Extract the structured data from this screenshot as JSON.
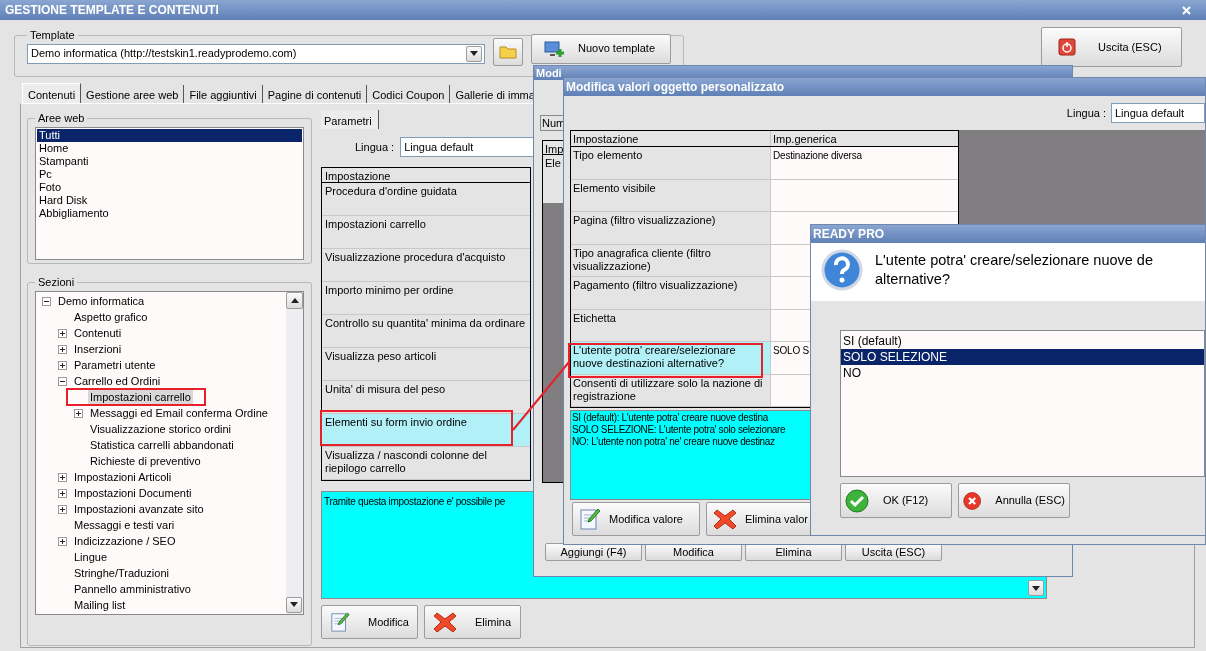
{
  "window": {
    "title": "GESTIONE TEMPLATE E CONTENUTI"
  },
  "template": {
    "label": "Template",
    "value": "Demo informatica (http://testskin1.readyprodemo.com)",
    "new_button": "Nuovo template"
  },
  "exit_button": "Uscita (ESC)",
  "tabs": [
    {
      "label": "Contenuti",
      "selected": true
    },
    {
      "label": "Gestione aree web",
      "selected": false
    },
    {
      "label": "File aggiuntivi",
      "selected": false
    },
    {
      "label": "Pagine di contenuti",
      "selected": false
    },
    {
      "label": "Codici Coupon",
      "selected": false
    },
    {
      "label": "Gallerie di imma",
      "selected": false
    }
  ],
  "web_areas": {
    "label": "Aree web",
    "items": [
      {
        "label": "Tutti",
        "selected": true
      },
      {
        "label": "Home",
        "selected": false
      },
      {
        "label": "Stampanti",
        "selected": false
      },
      {
        "label": "Pc",
        "selected": false
      },
      {
        "label": "Foto",
        "selected": false
      },
      {
        "label": "Hard Disk",
        "selected": false
      },
      {
        "label": "Abbigliamento",
        "selected": false
      }
    ]
  },
  "sections": {
    "label": "Sezioni",
    "tree": [
      {
        "label": "Demo informatica",
        "kind": "group",
        "expanded": true,
        "selected": false,
        "children": [
          {
            "label": "Aspetto grafico",
            "kind": "leaf",
            "selected": false
          },
          {
            "label": "Contenuti",
            "kind": "group",
            "expanded": false,
            "selected": false
          },
          {
            "label": "Inserzioni",
            "kind": "group",
            "expanded": false,
            "selected": false
          },
          {
            "label": "Parametri utente",
            "kind": "group",
            "expanded": false,
            "selected": false
          },
          {
            "label": "Carrello ed Ordini",
            "kind": "group",
            "expanded": true,
            "selected": false,
            "children": [
              {
                "label": "Impostazioni carrello",
                "kind": "leaf",
                "selected": true
              },
              {
                "label": "Messaggi ed Email conferma Ordine",
                "kind": "group",
                "expanded": false,
                "selected": false
              },
              {
                "label": "Visualizzazione storico ordini",
                "kind": "leaf",
                "selected": false
              },
              {
                "label": "Statistica carrelli abbandonati",
                "kind": "leaf",
                "selected": false
              },
              {
                "label": "Richieste di preventivo",
                "kind": "leaf",
                "selected": false
              }
            ]
          },
          {
            "label": "Impostazioni Articoli",
            "kind": "group",
            "expanded": false,
            "selected": false
          },
          {
            "label": "Impostazioni Documenti",
            "kind": "group",
            "expanded": false,
            "selected": false
          },
          {
            "label": "Impostazioni avanzate sito",
            "kind": "group",
            "expanded": false,
            "selected": false
          },
          {
            "label": "Messaggi e testi vari",
            "kind": "leaf",
            "selected": false
          },
          {
            "label": "Indicizzazione / SEO",
            "kind": "group",
            "expanded": false,
            "selected": false
          },
          {
            "label": "Lingue",
            "kind": "leaf",
            "selected": false
          },
          {
            "label": "Stringhe/Traduzioni",
            "kind": "leaf",
            "selected": false
          },
          {
            "label": "Pannello amministrativo",
            "kind": "leaf",
            "selected": false
          },
          {
            "label": "Mailing list",
            "kind": "leaf",
            "selected": false
          }
        ]
      }
    ]
  },
  "params_tab": "Parametri",
  "language": {
    "label": "Lingua :",
    "value": "Lingua default"
  },
  "settings_table": {
    "columns": [
      "Impostazione"
    ],
    "rows": [
      {
        "label": "Procedura d'ordine guidata",
        "selected": false
      },
      {
        "label": "Impostazioni carrello",
        "selected": false
      },
      {
        "label": "Visualizzazione procedura d'acquisto",
        "selected": false
      },
      {
        "label": "Importo minimo per ordine",
        "selected": false
      },
      {
        "label": "Controllo su quantita' minima da ordinare",
        "selected": false
      },
      {
        "label": "Visualizza peso articoli",
        "selected": false
      },
      {
        "label": "Unita' di misura del peso",
        "selected": false
      },
      {
        "label": "Elementi su form invio ordine",
        "selected": true
      },
      {
        "label": "Visualizza / nascondi colonne del riepilogo carrello",
        "selected": false
      }
    ]
  },
  "description": "Tramite questa impostazione e' possibile pe",
  "buttons": [
    {
      "label": "Modifica",
      "kind": "edit"
    },
    {
      "label": "Elimina",
      "kind": "delete"
    }
  ],
  "back_dialog": {
    "title": "Modi",
    "field": "Num",
    "column": "Imp",
    "row": "Ele",
    "buttons": [
      "Aggiungi (F4)",
      "Modifica",
      "Elimina",
      "Uscita (ESC)"
    ]
  },
  "edit_dialog": {
    "title": "Modifica valori oggetto personalizzato",
    "language": {
      "label": "Lingua :",
      "value": "Lingua default"
    },
    "columns": [
      "Impostazione",
      "Imp.generica"
    ],
    "rows": [
      {
        "label": "Tipo elemento",
        "value": "Destinazione diversa",
        "selected": false
      },
      {
        "label": "Elemento visibile",
        "selected": false
      },
      {
        "label": "Pagina (filtro visualizzazione)",
        "selected": false
      },
      {
        "label": "Tipo anagrafica cliente (filtro visualizzazione)",
        "selected": false
      },
      {
        "label": "Pagamento (filtro visualizzazione)",
        "selected": false
      },
      {
        "label": "Etichetta",
        "selected": false
      },
      {
        "label": "L'utente potra' creare/selezionare nuove destinazioni alternative?",
        "value": "SOLO S",
        "selected": true
      },
      {
        "label": "Consenti di utilizzare solo la nazione di registrazione",
        "selected": false
      }
    ],
    "description": [
      "SI (default): L'utente potra' creare nuove destina",
      "SOLO SELEZIONE: L'utente potra' solo selezionare",
      "NO: L'utente non potra' ne' creare nuove destinaz"
    ],
    "buttons": [
      {
        "label": "Modifica valore",
        "kind": "edit"
      },
      {
        "label": "Elimina valor",
        "kind": "delete"
      }
    ]
  },
  "confirm_dialog": {
    "title": "READY PRO",
    "question": [
      "L'utente potra' creare/selezionare nuove de",
      "alternative?"
    ],
    "options": [
      {
        "label": "SI (default)",
        "selected": false
      },
      {
        "label": "SOLO SELEZIONE",
        "selected": true
      },
      {
        "label": "NO",
        "selected": false
      }
    ],
    "buttons": [
      {
        "label": "OK (F12)",
        "kind": "ok"
      },
      {
        "label": "Annulla (ESC)",
        "kind": "cancel"
      }
    ]
  }
}
